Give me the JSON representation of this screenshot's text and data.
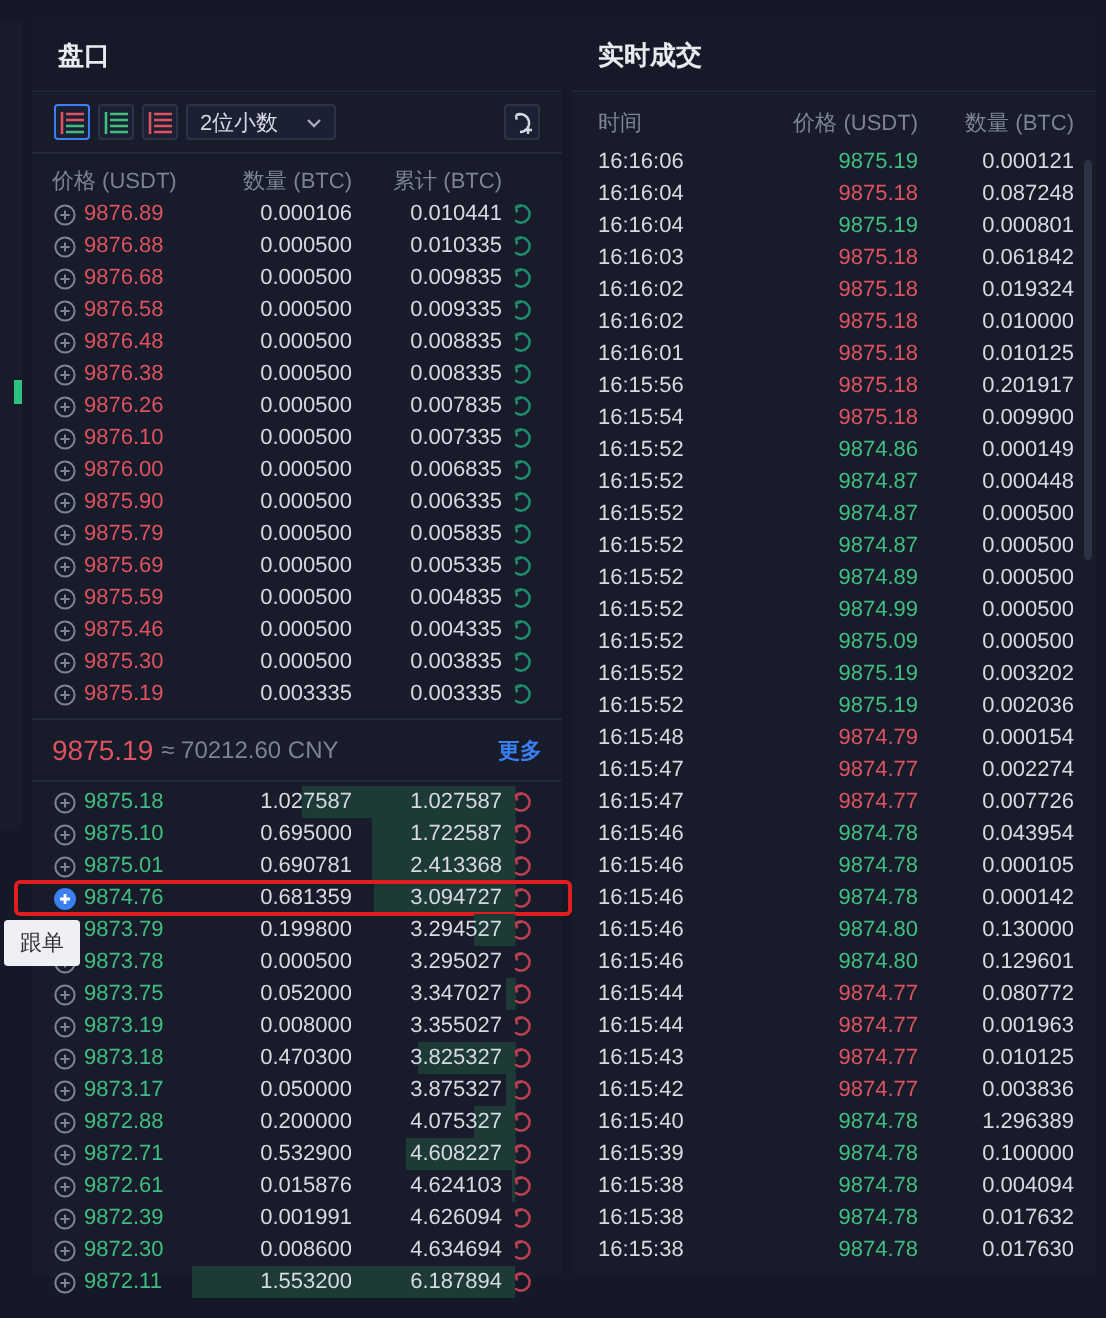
{
  "order_book": {
    "title": "盘口",
    "toolbar": {
      "views": [
        {
          "kind": "both",
          "selected": true
        },
        {
          "kind": "bids",
          "selected": false
        },
        {
          "kind": "asks",
          "selected": false
        }
      ],
      "precision": "2位小数"
    },
    "columns": [
      "价格 (USDT)",
      "数量 (BTC)",
      "累计 (BTC)"
    ],
    "asks": [
      {
        "price": "9876.89",
        "amount": "0.000106",
        "total": "0.010441"
      },
      {
        "price": "9876.88",
        "amount": "0.000500",
        "total": "0.010335"
      },
      {
        "price": "9876.68",
        "amount": "0.000500",
        "total": "0.009835"
      },
      {
        "price": "9876.58",
        "amount": "0.000500",
        "total": "0.009335"
      },
      {
        "price": "9876.48",
        "amount": "0.000500",
        "total": "0.008835"
      },
      {
        "price": "9876.38",
        "amount": "0.000500",
        "total": "0.008335"
      },
      {
        "price": "9876.26",
        "amount": "0.000500",
        "total": "0.007835"
      },
      {
        "price": "9876.10",
        "amount": "0.000500",
        "total": "0.007335"
      },
      {
        "price": "9876.00",
        "amount": "0.000500",
        "total": "0.006835"
      },
      {
        "price": "9875.90",
        "amount": "0.000500",
        "total": "0.006335"
      },
      {
        "price": "9875.79",
        "amount": "0.000500",
        "total": "0.005835"
      },
      {
        "price": "9875.69",
        "amount": "0.000500",
        "total": "0.005335"
      },
      {
        "price": "9875.59",
        "amount": "0.000500",
        "total": "0.004835"
      },
      {
        "price": "9875.46",
        "amount": "0.000500",
        "total": "0.004335"
      },
      {
        "price": "9875.30",
        "amount": "0.000500",
        "total": "0.003835"
      },
      {
        "price": "9875.19",
        "amount": "0.003335",
        "total": "0.003335"
      }
    ],
    "last_price": "9875.19",
    "fiat_price": "≈ 70212.60 CNY",
    "more_link": "更多",
    "bids": [
      {
        "price": "9875.18",
        "amount": "1.027587",
        "total": "1.027587",
        "selected": false
      },
      {
        "price": "9875.10",
        "amount": "0.695000",
        "total": "1.722587",
        "selected": false
      },
      {
        "price": "9875.01",
        "amount": "0.690781",
        "total": "2.413368",
        "selected": false
      },
      {
        "price": "9874.76",
        "amount": "0.681359",
        "total": "3.094727",
        "selected": true
      },
      {
        "price": "9873.79",
        "amount": "0.199800",
        "total": "3.294527",
        "selected": false
      },
      {
        "price": "9873.78",
        "amount": "0.000500",
        "total": "3.295027",
        "selected": false
      },
      {
        "price": "9873.75",
        "amount": "0.052000",
        "total": "3.347027",
        "selected": false
      },
      {
        "price": "9873.19",
        "amount": "0.008000",
        "total": "3.355027",
        "selected": false
      },
      {
        "price": "9873.18",
        "amount": "0.470300",
        "total": "3.825327",
        "selected": false
      },
      {
        "price": "9873.17",
        "amount": "0.050000",
        "total": "3.875327",
        "selected": false
      },
      {
        "price": "9872.88",
        "amount": "0.200000",
        "total": "4.075327",
        "selected": false
      },
      {
        "price": "9872.71",
        "amount": "0.532900",
        "total": "4.608227",
        "selected": false
      },
      {
        "price": "9872.61",
        "amount": "0.015876",
        "total": "4.624103",
        "selected": false
      },
      {
        "price": "9872.39",
        "amount": "0.001991",
        "total": "4.626094",
        "selected": false
      },
      {
        "price": "9872.30",
        "amount": "0.008600",
        "total": "4.634694",
        "selected": false
      },
      {
        "price": "9872.11",
        "amount": "1.553200",
        "total": "6.187894",
        "selected": false
      }
    ],
    "tooltip": "跟单"
  },
  "trades": {
    "title": "实时成交",
    "columns": [
      "时间",
      "价格 (USDT)",
      "数量 (BTC)"
    ],
    "rows": [
      {
        "time": "16:16:06",
        "price": "9875.19",
        "amount": "0.000121",
        "kind": "buy"
      },
      {
        "time": "16:16:04",
        "price": "9875.18",
        "amount": "0.087248",
        "kind": "sell"
      },
      {
        "time": "16:16:04",
        "price": "9875.19",
        "amount": "0.000801",
        "kind": "buy"
      },
      {
        "time": "16:16:03",
        "price": "9875.18",
        "amount": "0.061842",
        "kind": "sell"
      },
      {
        "time": "16:16:02",
        "price": "9875.18",
        "amount": "0.019324",
        "kind": "sell"
      },
      {
        "time": "16:16:02",
        "price": "9875.18",
        "amount": "0.010000",
        "kind": "sell"
      },
      {
        "time": "16:16:01",
        "price": "9875.18",
        "amount": "0.010125",
        "kind": "sell"
      },
      {
        "time": "16:15:56",
        "price": "9875.18",
        "amount": "0.201917",
        "kind": "sell"
      },
      {
        "time": "16:15:54",
        "price": "9875.18",
        "amount": "0.009900",
        "kind": "sell"
      },
      {
        "time": "16:15:52",
        "price": "9874.86",
        "amount": "0.000149",
        "kind": "buy"
      },
      {
        "time": "16:15:52",
        "price": "9874.87",
        "amount": "0.000448",
        "kind": "buy"
      },
      {
        "time": "16:15:52",
        "price": "9874.87",
        "amount": "0.000500",
        "kind": "buy"
      },
      {
        "time": "16:15:52",
        "price": "9874.87",
        "amount": "0.000500",
        "kind": "buy"
      },
      {
        "time": "16:15:52",
        "price": "9874.89",
        "amount": "0.000500",
        "kind": "buy"
      },
      {
        "time": "16:15:52",
        "price": "9874.99",
        "amount": "0.000500",
        "kind": "buy"
      },
      {
        "time": "16:15:52",
        "price": "9875.09",
        "amount": "0.000500",
        "kind": "buy"
      },
      {
        "time": "16:15:52",
        "price": "9875.19",
        "amount": "0.003202",
        "kind": "buy"
      },
      {
        "time": "16:15:52",
        "price": "9875.19",
        "amount": "0.002036",
        "kind": "buy"
      },
      {
        "time": "16:15:48",
        "price": "9874.79",
        "amount": "0.000154",
        "kind": "sell"
      },
      {
        "time": "16:15:47",
        "price": "9874.77",
        "amount": "0.002274",
        "kind": "sell"
      },
      {
        "time": "16:15:47",
        "price": "9874.77",
        "amount": "0.007726",
        "kind": "sell"
      },
      {
        "time": "16:15:46",
        "price": "9874.78",
        "amount": "0.043954",
        "kind": "buy"
      },
      {
        "time": "16:15:46",
        "price": "9874.78",
        "amount": "0.000105",
        "kind": "buy"
      },
      {
        "time": "16:15:46",
        "price": "9874.78",
        "amount": "0.000142",
        "kind": "buy"
      },
      {
        "time": "16:15:46",
        "price": "9874.80",
        "amount": "0.130000",
        "kind": "buy"
      },
      {
        "time": "16:15:46",
        "price": "9874.80",
        "amount": "0.129601",
        "kind": "buy"
      },
      {
        "time": "16:15:44",
        "price": "9874.77",
        "amount": "0.080772",
        "kind": "sell"
      },
      {
        "time": "16:15:44",
        "price": "9874.77",
        "amount": "0.001963",
        "kind": "sell"
      },
      {
        "time": "16:15:43",
        "price": "9874.77",
        "amount": "0.010125",
        "kind": "sell"
      },
      {
        "time": "16:15:42",
        "price": "9874.77",
        "amount": "0.003836",
        "kind": "sell"
      },
      {
        "time": "16:15:40",
        "price": "9874.78",
        "amount": "1.296389",
        "kind": "buy"
      },
      {
        "time": "16:15:39",
        "price": "9874.78",
        "amount": "0.100000",
        "kind": "buy"
      },
      {
        "time": "16:15:38",
        "price": "9874.78",
        "amount": "0.004094",
        "kind": "buy"
      },
      {
        "time": "16:15:38",
        "price": "9874.78",
        "amount": "0.017632",
        "kind": "buy"
      },
      {
        "time": "16:15:38",
        "price": "9874.78",
        "amount": "0.017630",
        "kind": "buy"
      }
    ]
  }
}
